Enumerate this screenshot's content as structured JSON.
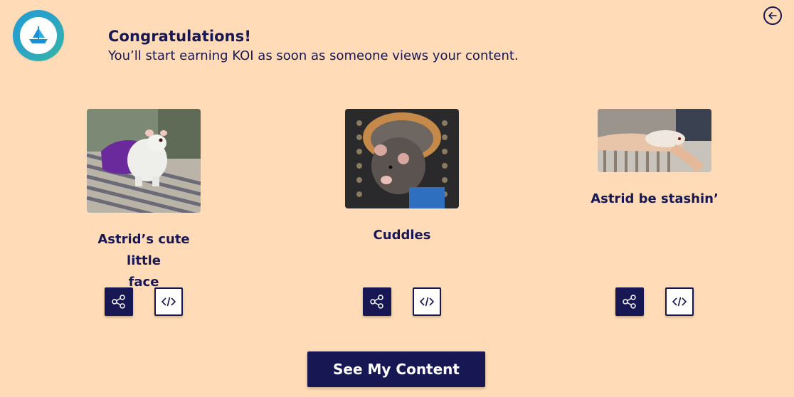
{
  "header": {
    "logo_icon": "koi-ship-logo-icon",
    "back_icon": "arrow-left-circle-icon",
    "title": "Congratulations!",
    "subtitle": "You’ll start earning KOI as soon as someone views your content."
  },
  "cards": [
    {
      "caption_line1": "Astrid’s cute little",
      "caption_line2": "face",
      "share_icon": "share-icon",
      "embed_icon": "code-embed-icon"
    },
    {
      "caption_line1": "Cuddles",
      "share_icon": "share-icon",
      "embed_icon": "code-embed-icon"
    },
    {
      "caption_line1": "Astrid be stashin’",
      "share_icon": "share-icon",
      "embed_icon": "code-embed-icon"
    }
  ],
  "actions": {
    "primary_label": "See My Content"
  },
  "colors": {
    "background": "#ffdcb7",
    "primary": "#171753",
    "logo_gradient_start": "#1f9dd0",
    "logo_gradient_end": "#36b6a3"
  }
}
